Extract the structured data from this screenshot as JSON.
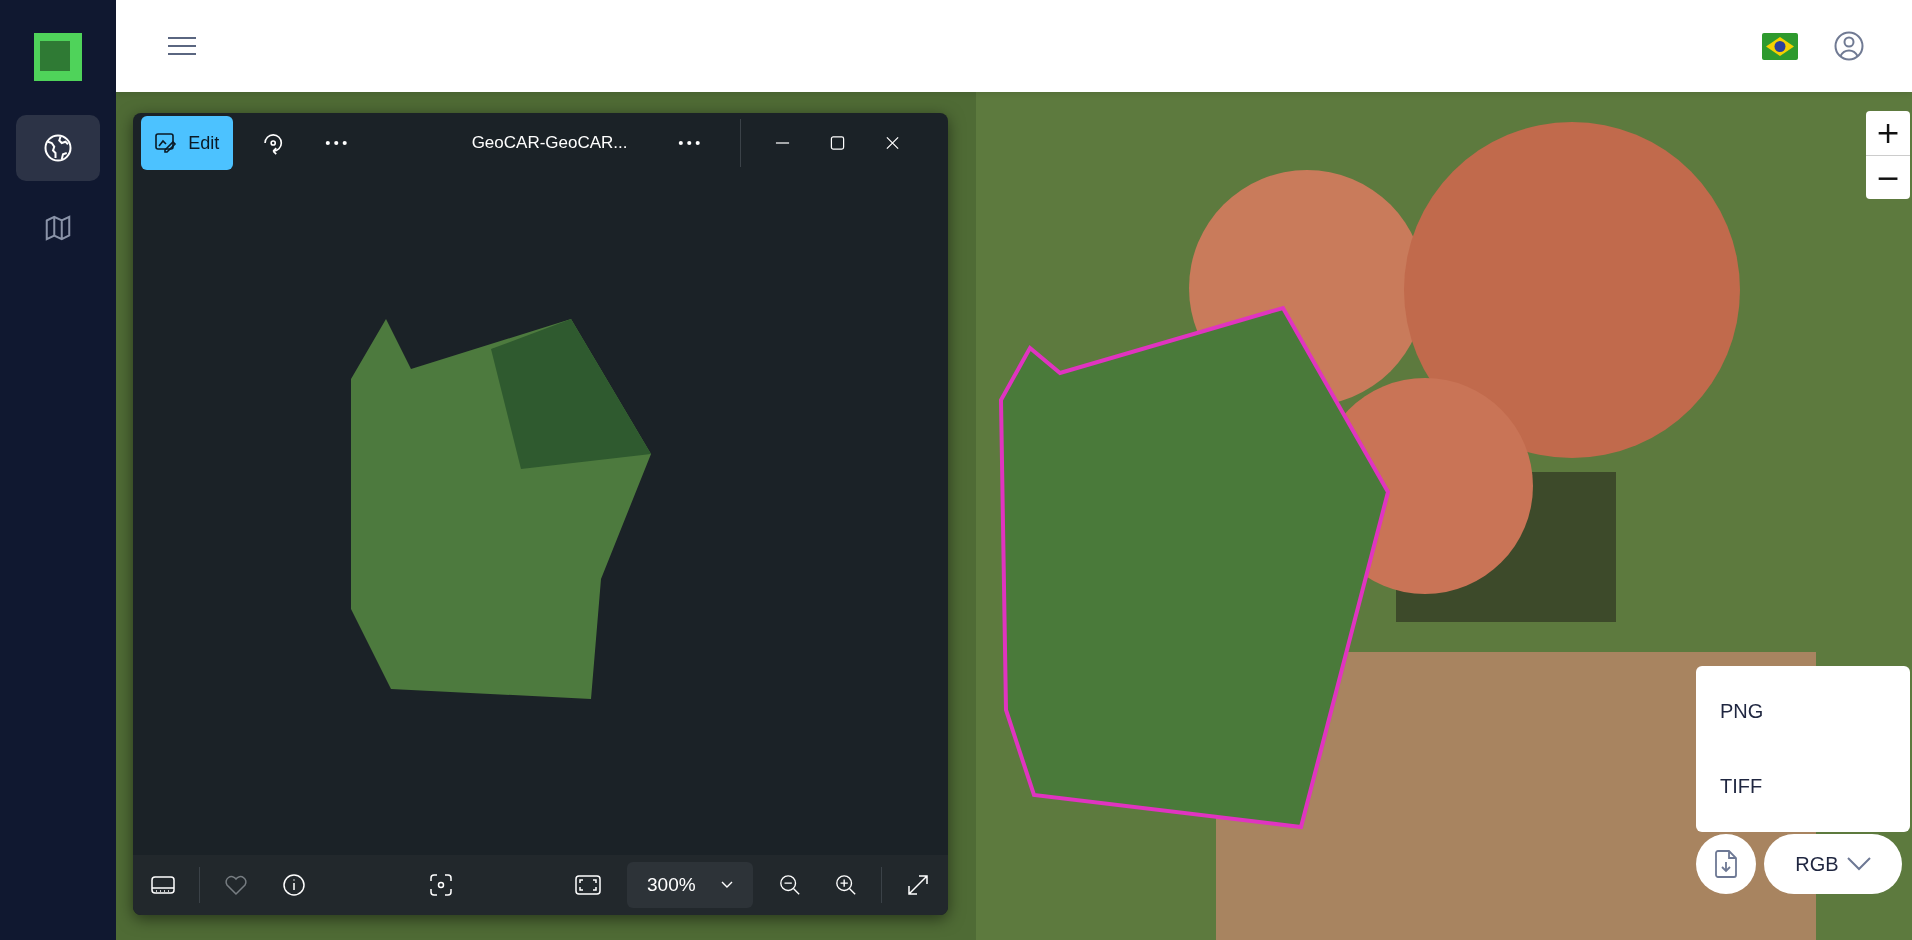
{
  "sidebar": {
    "items": [
      {
        "kind": "globe",
        "selected": true
      },
      {
        "kind": "map",
        "selected": false
      }
    ]
  },
  "map": {
    "zoom_in": "+",
    "zoom_out": "−"
  },
  "viewer": {
    "edit_button": "Edit",
    "title": "GeoCAR-GeoCAR...",
    "zoom_level": "300%",
    "favorite": false
  },
  "export_menu": {
    "items": [
      "PNG",
      "TIFF"
    ],
    "band_select": "RGB"
  }
}
